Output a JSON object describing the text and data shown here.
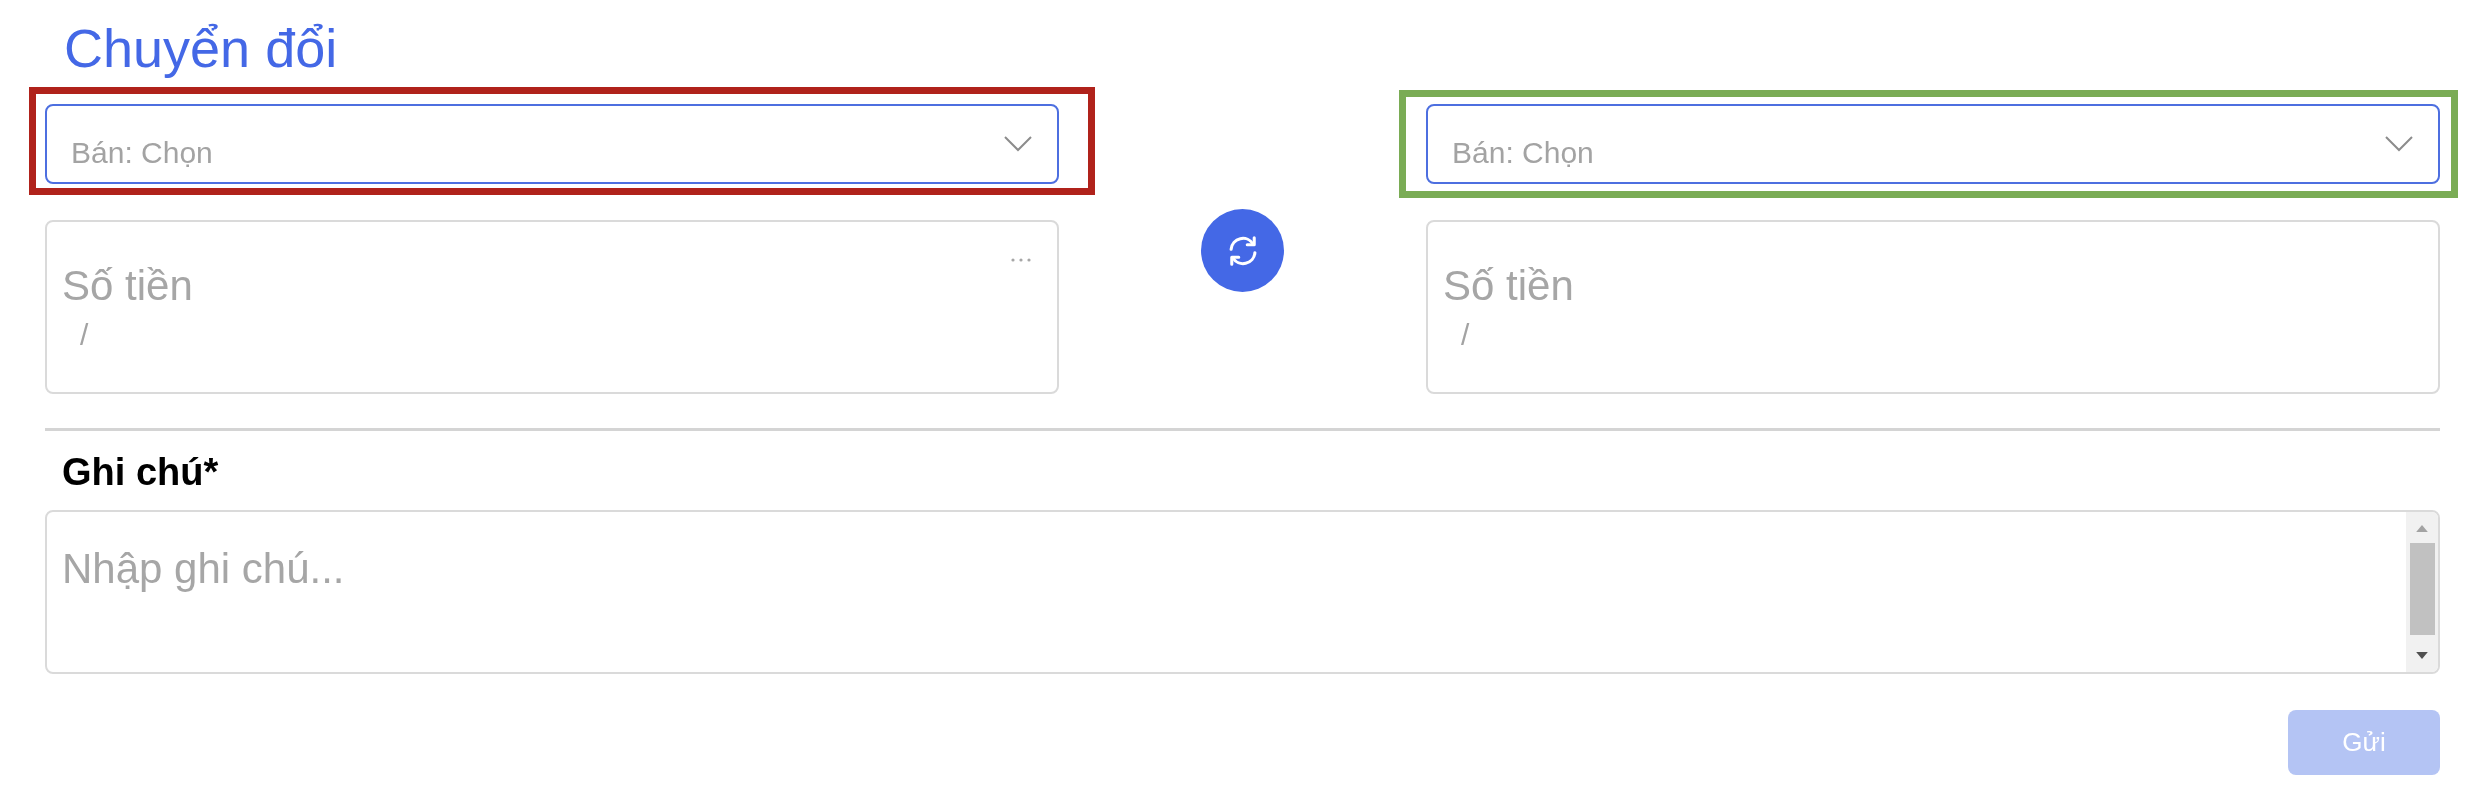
{
  "title": "Chuyển đổi",
  "converters": [
    {
      "color": "#b0221b",
      "select": {
        "label": "Bán: Chọn"
      },
      "amount": {
        "placeholder": "Số tiền",
        "rate": "/",
        "more_menu": true
      }
    },
    {
      "color": "#7aac55",
      "select": {
        "label": "Bán: Chọn"
      },
      "amount": {
        "placeholder": "Số tiền",
        "rate": "/",
        "more_menu": false
      }
    }
  ],
  "note": {
    "label": "Ghi chú*",
    "placeholder": "Nhập ghi chú..."
  },
  "submit": {
    "label": "Gửi",
    "disabled": true
  }
}
